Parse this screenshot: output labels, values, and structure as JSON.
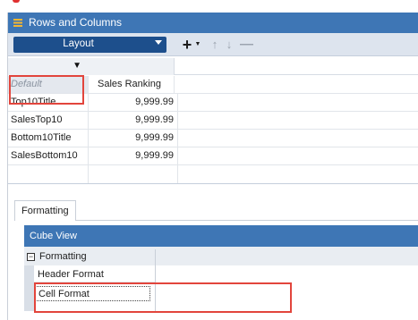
{
  "window": {
    "title": "Rows and Columns",
    "accent": "#3e76b5",
    "highlight": "#e2453c"
  },
  "toolbar": {
    "layout_label": "Layout",
    "icons": [
      "add-icon",
      "dropdown-caret-icon",
      "move-up-icon",
      "move-down-icon",
      "remove-icon"
    ]
  },
  "grid": {
    "header": [
      "",
      "Sales Ranking"
    ],
    "rows": [
      {
        "label": "Default",
        "value": ""
      },
      {
        "label": "Top10Title",
        "value": "9,999.99"
      },
      {
        "label": "SalesTop10",
        "value": "9,999.99"
      },
      {
        "label": "Bottom10Title",
        "value": "9,999.99"
      },
      {
        "label": "SalesBottom10",
        "value": "9,999.99"
      }
    ]
  },
  "tabs": {
    "formatting": "Formatting"
  },
  "cube_view": {
    "header": "Cube View",
    "group": "Formatting",
    "properties": [
      "Header Format",
      "Cell Format"
    ]
  }
}
